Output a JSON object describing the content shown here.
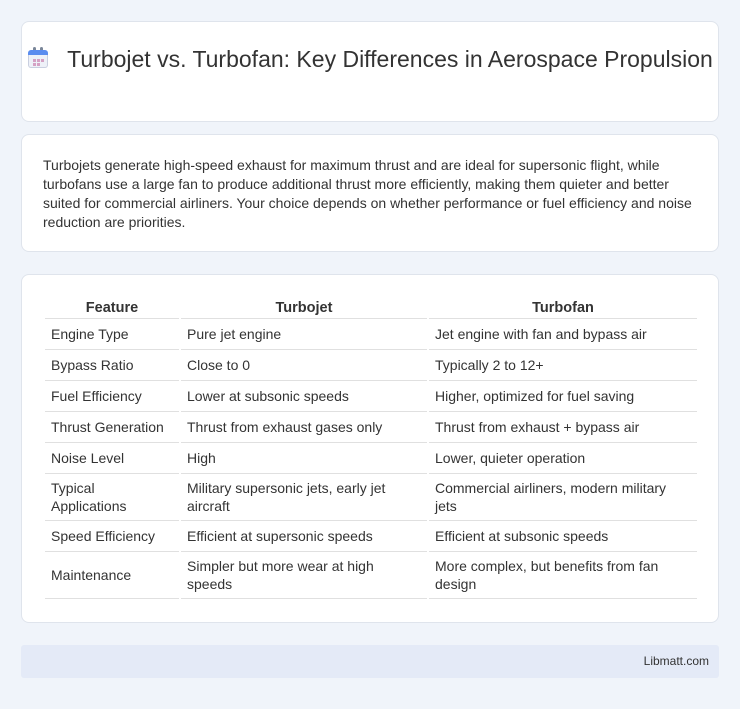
{
  "header": {
    "icon": "calendar-icon",
    "title": "Turbojet vs. Turbofan: Key Differences in Aerospace Propulsion"
  },
  "intro": {
    "text": "Turbojets generate high-speed exhaust for maximum thrust and are ideal for supersonic flight, while turbofans use a large fan to produce additional thrust more efficiently, making them quieter and better suited for commercial airliners. Your choice depends on whether performance or fuel efficiency and noise reduction are priorities."
  },
  "table": {
    "headers": [
      "Feature",
      "Turbojet",
      "Turbofan"
    ],
    "rows": [
      [
        "Engine Type",
        "Pure jet engine",
        "Jet engine with fan and bypass air"
      ],
      [
        "Bypass Ratio",
        "Close to 0",
        "Typically 2 to 12+"
      ],
      [
        "Fuel Efficiency",
        "Lower at subsonic speeds",
        "Higher, optimized for fuel saving"
      ],
      [
        "Thrust Generation",
        "Thrust from exhaust gases only",
        "Thrust from exhaust + bypass air"
      ],
      [
        "Noise Level",
        "High",
        "Lower, quieter operation"
      ],
      [
        "Typical Applications",
        "Military supersonic jets, early jet aircraft",
        "Commercial airliners, modern military jets"
      ],
      [
        "Speed Efficiency",
        "Efficient at supersonic speeds",
        "Efficient at subsonic speeds"
      ],
      [
        "Maintenance",
        "Simpler but more wear at high speeds",
        "More complex, but benefits from fan design"
      ]
    ]
  },
  "footer": {
    "source": "Libmatt.com"
  }
}
